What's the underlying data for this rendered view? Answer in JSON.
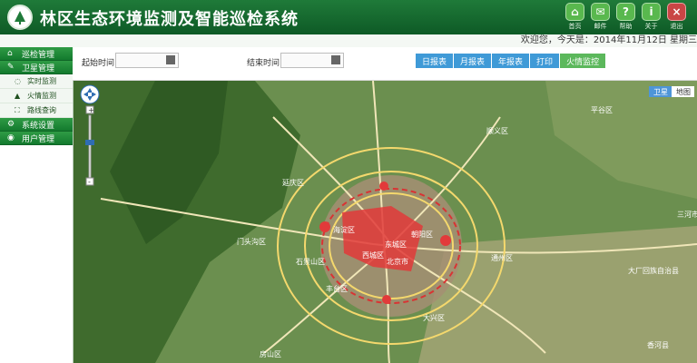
{
  "header": {
    "title": "林区生态环境监测及智能巡检系统",
    "buttons": [
      {
        "name": "home",
        "label": "首页",
        "color": "#59b84e",
        "glyph": "⌂"
      },
      {
        "name": "mail",
        "label": "邮件",
        "color": "#59b84e",
        "glyph": "✉"
      },
      {
        "name": "help",
        "label": "帮助",
        "color": "#59b84e",
        "glyph": "?"
      },
      {
        "name": "about",
        "label": "关于",
        "color": "#59b84e",
        "glyph": "i"
      },
      {
        "name": "logout",
        "label": "退出",
        "color": "#c94545",
        "glyph": "×"
      }
    ]
  },
  "welcome": "欢迎您，今天是：2014年11月12日 星期三",
  "sidebar": {
    "items": [
      {
        "name": "patrol-management",
        "label": "巡检管理",
        "icon": "house-icon",
        "type": "main"
      },
      {
        "name": "satellite-management",
        "label": "卫星管理",
        "icon": "note-icon",
        "type": "main"
      },
      {
        "name": "realtime-monitor",
        "label": "实时监测",
        "icon": "satellite-icon",
        "type": "sub"
      },
      {
        "name": "fire-monitor",
        "label": "火情监测",
        "icon": "fire-icon",
        "type": "sub"
      },
      {
        "name": "route-query",
        "label": "路线查询",
        "icon": "route-icon",
        "type": "sub"
      },
      {
        "name": "system-settings",
        "label": "系统设置",
        "icon": "gear-icon",
        "type": "main"
      },
      {
        "name": "user-management",
        "label": "用户管理",
        "icon": "user-icon",
        "type": "main"
      }
    ]
  },
  "toolbar": {
    "start_label": "起始时间:",
    "end_label": "结束时间:",
    "buttons": [
      {
        "name": "daily-report",
        "label": "日报表",
        "color": "#3f9ad7"
      },
      {
        "name": "monthly-report",
        "label": "月报表",
        "color": "#3f9ad7"
      },
      {
        "name": "yearly-report",
        "label": "年报表",
        "color": "#3f9ad7"
      },
      {
        "name": "print",
        "label": "打印",
        "color": "#3f9ad7"
      },
      {
        "name": "fire-monitor-button",
        "label": "火情监控",
        "color": "#5cb85c"
      }
    ]
  },
  "map": {
    "toggles": [
      "卫星",
      "地图"
    ],
    "labels": [
      "延庆区",
      "顺义区",
      "平谷区",
      "海淀区",
      "朝阳区",
      "通州区",
      "西城区",
      "东城区",
      "北京市",
      "门头沟区",
      "石景山区",
      "丰台区",
      "大兴区",
      "房山区",
      "大厂回族自治县",
      "香河县",
      "三河市"
    ]
  }
}
